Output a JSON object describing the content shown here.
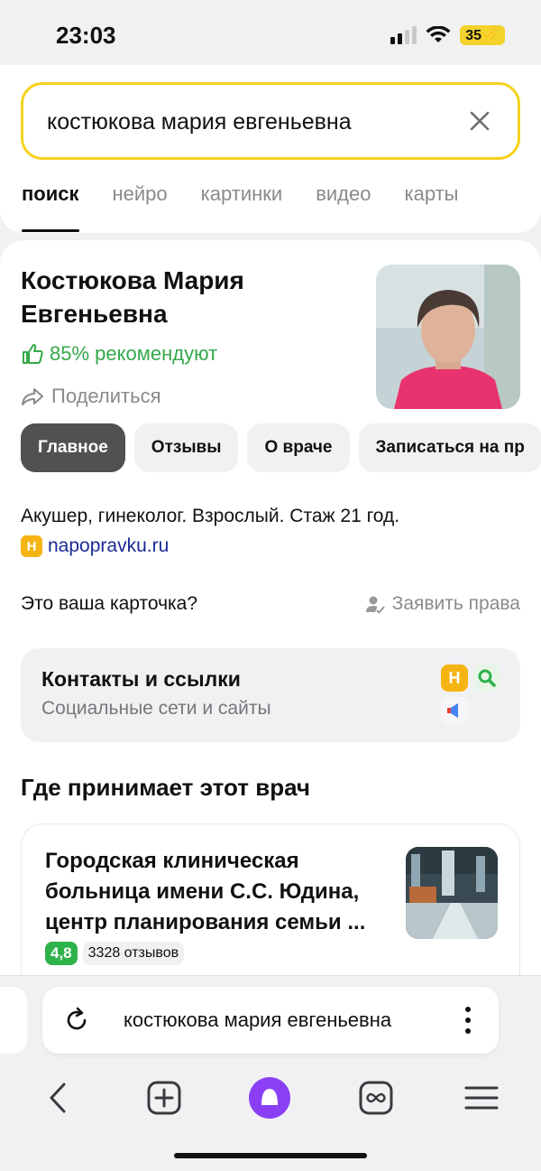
{
  "status": {
    "time": "23:03",
    "battery": "35"
  },
  "search": {
    "query": "костюкова мария евгеньевна",
    "tabs": [
      "поиск",
      "нейро",
      "картинки",
      "видео",
      "карты"
    ]
  },
  "profile": {
    "name": "Костюкова Мария Евгеньевна",
    "recommend": "85% рекомендуют",
    "share": "Поделиться",
    "chips": [
      "Главное",
      "Отзывы",
      "О враче",
      "Записаться на пр"
    ],
    "description": "Акушер, гинеколог. Взрослый. Стаж 21 год.",
    "source_badge": "H",
    "source": "napopravku.ru",
    "your_card": "Это ваша карточка?",
    "claim": "Заявить права"
  },
  "contacts": {
    "title": "Контакты и ссылки",
    "subtitle": "Социальные сети и сайты",
    "badge_h": "H"
  },
  "clinics": {
    "heading": "Где принимает этот врач",
    "items": [
      {
        "name": "Городская клиническая больница имени С.С. Юдина, центр планирования семьи ...",
        "rating": "4,8",
        "reviews": "3328 отзывов"
      }
    ]
  },
  "browser": {
    "url_text": "костюкова мария евгеньевна"
  },
  "colors": {
    "accent_yellow": "#f6d21f",
    "green": "#35a84a",
    "link": "#1a2996",
    "alice": "#8b3ff5"
  },
  "icons": [
    "signal-icon",
    "wifi-icon",
    "battery-icon",
    "clear-icon",
    "thumbs-up-icon",
    "share-icon",
    "claim-user-icon",
    "napopravku-icon",
    "search-service-icon",
    "megaphone-icon",
    "reload-icon",
    "more-icon",
    "back-icon",
    "new-tab-icon",
    "alice-icon",
    "tabs-icon",
    "menu-icon"
  ]
}
